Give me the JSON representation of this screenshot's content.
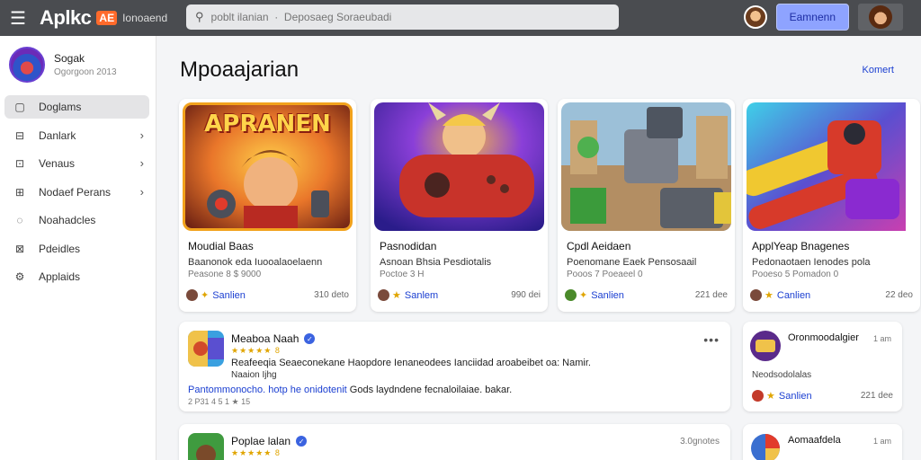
{
  "header": {
    "logo_text": "Aplkc",
    "logo_badge": "AE",
    "logo_sub": "Ionoaend",
    "search_placeholder": "poblt ilanian  ·  Deposaeg Soraeubadi",
    "button_label": "Eamnenn"
  },
  "sidebar": {
    "profile_name": "Sogak",
    "profile_sub": "Ogorgoon 2013",
    "items": [
      {
        "label": "Doglams",
        "icon": "square-icon",
        "active": true,
        "chevron": false
      },
      {
        "label": "Danlark",
        "icon": "minus-square-icon",
        "active": false,
        "chevron": true
      },
      {
        "label": "Venaus",
        "icon": "image-square-icon",
        "active": false,
        "chevron": true
      },
      {
        "label": "Nodaef Perans",
        "icon": "list-square-icon",
        "active": false,
        "chevron": true
      },
      {
        "label": "Noahadcles",
        "icon": "circle-icon",
        "active": false,
        "chevron": false
      },
      {
        "label": "Pdeidles",
        "icon": "grid-icon",
        "active": false,
        "chevron": false
      },
      {
        "label": "Applaids",
        "icon": "gear-icon",
        "active": false,
        "chevron": false
      }
    ]
  },
  "main": {
    "title": "Mpoaajarian",
    "link": "Komert"
  },
  "cards": [
    {
      "banner": "APRANEN",
      "title": "Moudial Baas",
      "desc": "Baanonok eda Iuooalaoelaenn",
      "meta": "Peasone 8 $ 9000",
      "author": "Sanlien",
      "count": "310 deto",
      "star": "✦"
    },
    {
      "banner": "",
      "title": "Pasnodidan",
      "desc": "Asnoan Bhsia Pesdiotalis",
      "meta": "Poctoe 3 H",
      "author": "Sanlem",
      "count": "990 dei",
      "star": "★"
    },
    {
      "banner": "",
      "title": "Cpdl Aeidaen",
      "desc": "Poenomane Eaek Pensosaail",
      "meta": "Pooos 7 Poeaeel 0",
      "author": "Sanlien",
      "count": "221 dee",
      "star": "✦"
    },
    {
      "banner": "",
      "title": "ApplYeap Bnagenes",
      "desc": "Pedonaotaen Ienodes pola",
      "meta": "Pooeso 5 Pomadon 0",
      "author": "Canlien",
      "count": "22 deo",
      "star": "★"
    }
  ],
  "posts": [
    {
      "title": "Meaboa Naah",
      "rating": "★★★★★ 8",
      "body": "Reafeeqia Seaeconekane Haopdore Ienaneodees Ianciidad aroabeibet oa: Namir.",
      "sub": "Naaion Ijhg",
      "link_highlight": "Pantommonocho. hotp he onidotenit",
      "link_rest": " Gods laydndene fecnaloilaiae. bakar.",
      "meta": "2 P31 4 5 1 ★ 15",
      "time": ""
    },
    {
      "title": "Poplae lalan",
      "rating": "★★★★★ 8",
      "body": "",
      "sub": "",
      "link_highlight": "",
      "link_rest": "",
      "meta": "",
      "time": "3.0gnotes"
    }
  ],
  "side_cards": [
    {
      "title": "Oronmoodalgier",
      "time": "1 am",
      "desc": "Neodsodolalas",
      "author": "Sanlien",
      "count": "221 dee"
    },
    {
      "title": "Aomaafdela",
      "time": "1 am",
      "desc": "",
      "author": "",
      "count": ""
    }
  ]
}
